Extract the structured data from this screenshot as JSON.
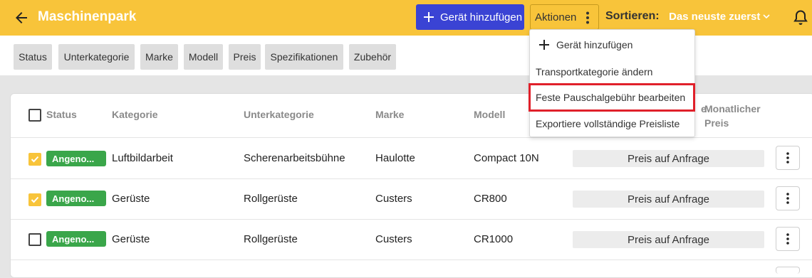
{
  "header": {
    "title": "Maschinenpark",
    "add_device_label": "Gerät hinzufügen",
    "actions_label": "Aktionen",
    "sort_label": "Sortieren:",
    "sort_value": "Das neuste zuerst"
  },
  "filters": [
    "Status",
    "Unterkategorie",
    "Marke",
    "Modell",
    "Preis",
    "Spezifikationen",
    "Zubehör"
  ],
  "table": {
    "columns": {
      "status": "Status",
      "kategorie": "Kategorie",
      "unterkategorie": "Unterkategorie",
      "marke": "Marke",
      "modell": "Modell",
      "monthly_line1": "Monatlicher",
      "monthly_line2": "Preis",
      "hidden_prefix": "e"
    },
    "rows": [
      {
        "checked": true,
        "status": "Angeno...",
        "kategorie": "Luftbildarbeit",
        "unterkategorie": "Scherenarbeitsbühne",
        "marke": "Haulotte",
        "modell": "Compact 10N",
        "preis": "Preis auf Anfrage"
      },
      {
        "checked": true,
        "status": "Angeno...",
        "kategorie": "Gerüste",
        "unterkategorie": "Rollgerüste",
        "marke": "Custers",
        "modell": "CR800",
        "preis": "Preis auf Anfrage"
      },
      {
        "checked": false,
        "status": "Angeno...",
        "kategorie": "Gerüste",
        "unterkategorie": "Rollgerüste",
        "marke": "Custers",
        "modell": "CR1000",
        "preis": "Preis auf Anfrage"
      }
    ]
  },
  "dropdown": {
    "items": [
      "Gerät hinzufügen",
      "Transportkategorie ändern",
      "Feste Pauschalgebühr bearbeiten",
      "Exportiere vollständige Preisliste"
    ],
    "highlighted_index": 2
  },
  "colors": {
    "header": "#f8c43a",
    "primary_button": "#3a43d4",
    "status_badge": "#3aa64a",
    "highlight_border": "#e0202a"
  }
}
